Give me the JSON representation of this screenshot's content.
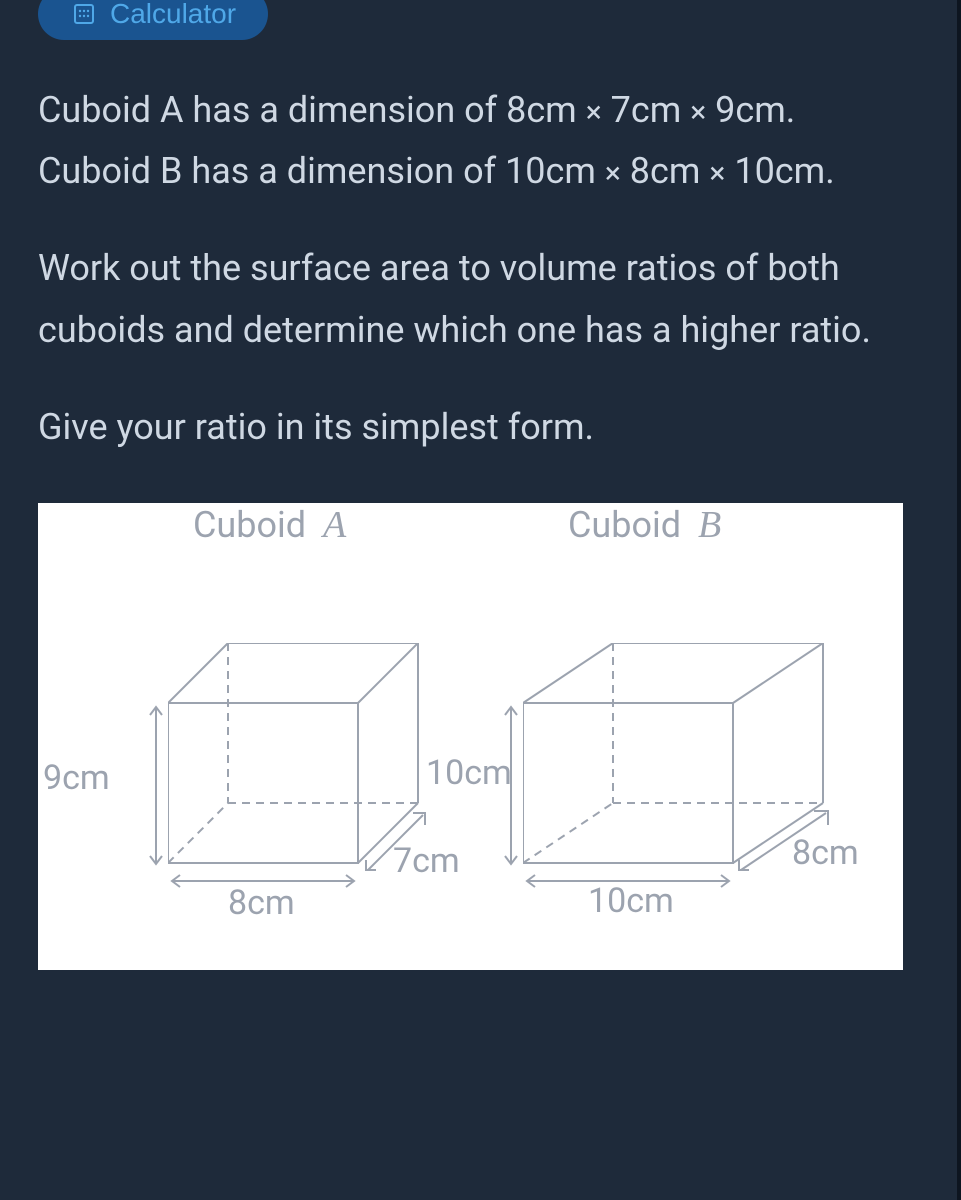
{
  "calculator": {
    "label": "Calculator"
  },
  "question": {
    "line1a": "Cuboid A has a dimension of 8cm ",
    "line1b": " 7cm  ",
    "line1c": "  9cm.",
    "line2a": "Cuboid B has a dimension of 10cm ",
    "line2b": " 8cm  ",
    "line2c": "  10cm.",
    "line3": "Work out the surface area to volume ratios of both cuboids and determine which one has a higher ratio.",
    "line4": "Give your ratio in its simplest form."
  },
  "diagram": {
    "cuboidA": {
      "title": "Cuboid",
      "letter": "A",
      "height": "9cm",
      "width": "8cm",
      "depth": "7cm"
    },
    "cuboidB": {
      "title": "Cuboid",
      "letter": "B",
      "height": "10cm",
      "width": "10cm",
      "depth": "8cm"
    }
  },
  "times_symbol": "×"
}
